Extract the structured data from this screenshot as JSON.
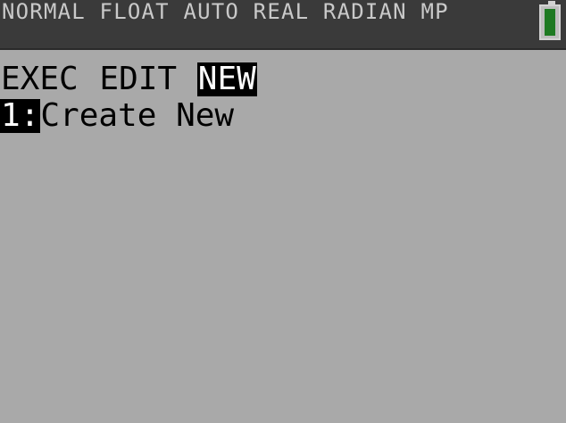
{
  "status_bar": {
    "text": "NORMAL FLOAT AUTO REAL RADIAN MP",
    "battery": {
      "level": 1.0,
      "color": "#1e7a22"
    }
  },
  "menu": {
    "tabs": [
      {
        "label": "EXEC",
        "active": false
      },
      {
        "label": "EDIT",
        "active": false
      },
      {
        "label": "NEW",
        "active": true
      }
    ],
    "items": [
      {
        "number": "1:",
        "label": "Create New",
        "selected": true
      }
    ]
  },
  "colors": {
    "screen_background": "#a9a9a9",
    "status_bar_background": "#3a3a3a",
    "status_text": "#c9c9c9",
    "highlight_background": "#000000",
    "highlight_text": "#ffffff"
  }
}
